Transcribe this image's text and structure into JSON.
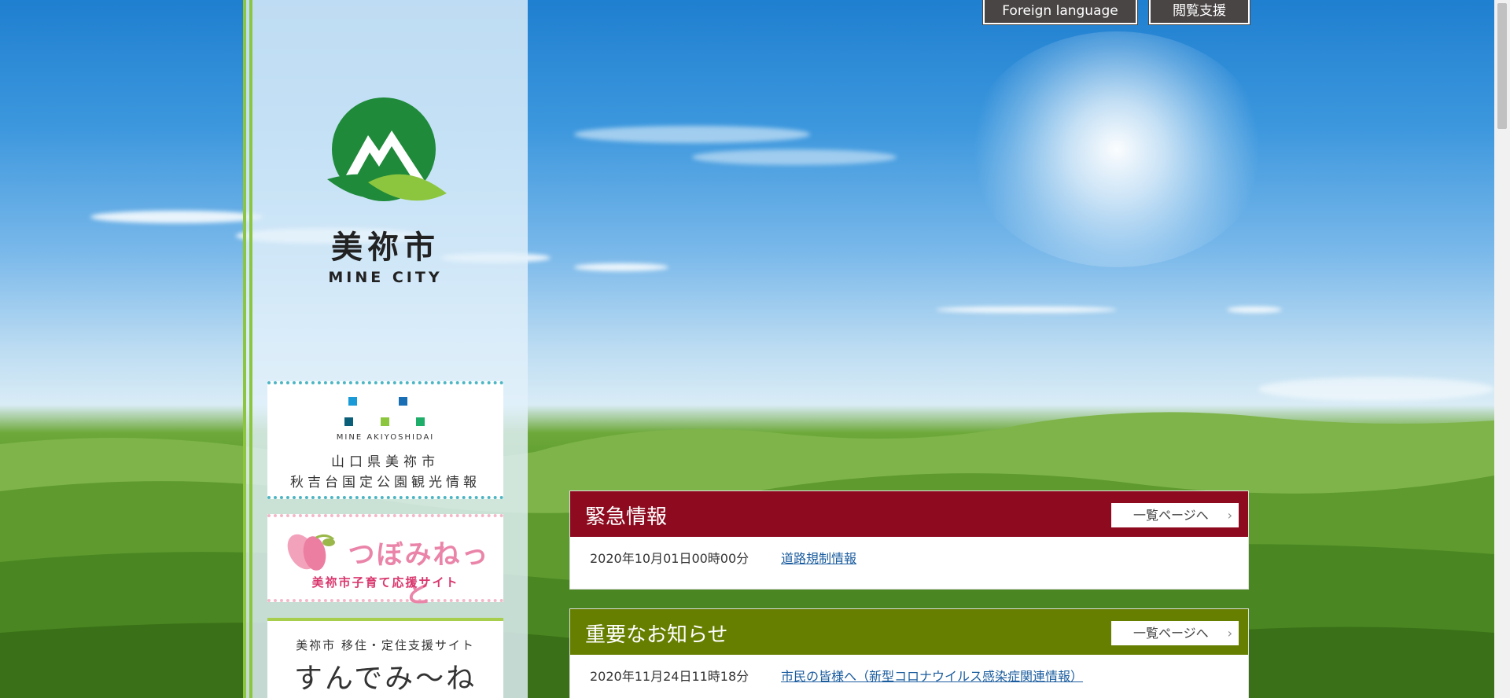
{
  "header": {
    "foreign_language": "Foreign language",
    "reading_support": "閲覧支援"
  },
  "logo": {
    "name_jp": "美祢市",
    "name_en": "MINE CITY",
    "colors": {
      "green": "#1e8a3a",
      "lime": "#8cc63f"
    }
  },
  "sidebar": {
    "banners": [
      {
        "tag": "MINE AKIYOSHIDAI",
        "line1": "山口県美祢市",
        "line2": "秋吉台国定公園観光情報",
        "square_colors": [
          "#1a9ad6",
          "#1a6fb4",
          "#0a5e78",
          "#8cc63f",
          "#1fae6a"
        ]
      },
      {
        "title": "つぼみねっと",
        "subtitle": "美祢市子育て応援サイト"
      },
      {
        "line1": "美祢市 移住・定住支援サイト",
        "line2": "すんでみ〜ね"
      }
    ]
  },
  "panels": {
    "emergency": {
      "title": "緊急情報",
      "more": "一覧ページへ",
      "color": "#8e0b1f",
      "items": [
        {
          "date": "2020年10月01日00時00分",
          "link": "道路規制情報"
        }
      ]
    },
    "important": {
      "title": "重要なお知らせ",
      "more": "一覧ページへ",
      "color": "#667f00",
      "items": [
        {
          "date": "2020年11月24日11時18分",
          "link": "市民の皆様へ（新型コロナウイルス感染症関連情報）"
        }
      ]
    }
  }
}
